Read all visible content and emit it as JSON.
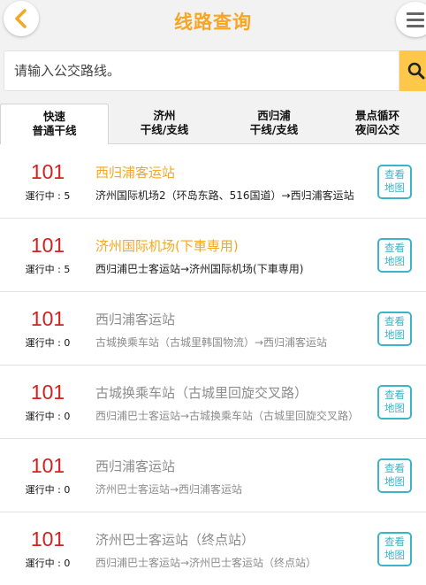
{
  "header": {
    "title": "线路查询",
    "back_icon": "chevron-left-icon",
    "menu_icon": "hamburger-menu-icon",
    "accent_color": "#f5a623"
  },
  "search": {
    "placeholder": "请输入公交路线。",
    "button_icon": "search-icon",
    "button_color": "#ffc84a"
  },
  "tabs": [
    {
      "line1": "快速",
      "line2": "普通干线",
      "active": true
    },
    {
      "line1": "济州",
      "line2": "干线/支线",
      "active": false
    },
    {
      "line1": "西归浦",
      "line2": "干线/支线",
      "active": false
    },
    {
      "line1": "景点循环",
      "line2": "夜间公交",
      "active": false
    }
  ],
  "routes": [
    {
      "number": "101",
      "status": "運行中 : 5",
      "title": "西归浦客运站",
      "route": "济州国际机场2（环岛东路、516国道）→西归浦客运站",
      "active": true,
      "map_line1": "查看",
      "map_line2": "地图"
    },
    {
      "number": "101",
      "status": "運行中 : 5",
      "title": "济州国际机场(下車専用)",
      "route": "西归浦巴士客运站→济州国际机场(下車専用)",
      "active": true,
      "map_line1": "查看",
      "map_line2": "地图"
    },
    {
      "number": "101",
      "status": "運行中 : 0",
      "title": "西归浦客运站",
      "route": "古城换乘车站（古城里韩国物流）→西归浦客运站",
      "active": false,
      "map_line1": "查看",
      "map_line2": "地图"
    },
    {
      "number": "101",
      "status": "運行中 : 0",
      "title": "古城换乘车站（古城里回旋交叉路）",
      "route": "西归浦巴士客运站→古城换乘车站（古城里回旋交叉路）",
      "active": false,
      "map_line1": "查看",
      "map_line2": "地图"
    },
    {
      "number": "101",
      "status": "運行中 : 0",
      "title": "西归浦客运站",
      "route": "济州巴士客运站→西归浦客运站",
      "active": false,
      "map_line1": "查看",
      "map_line2": "地图"
    },
    {
      "number": "101",
      "status": "運行中 : 0",
      "title": "济州巴士客运站（终点站）",
      "route": "西归浦巴士客运站→济州巴士客运站（终点站）",
      "active": false,
      "map_line1": "查看",
      "map_line2": "地图"
    }
  ]
}
